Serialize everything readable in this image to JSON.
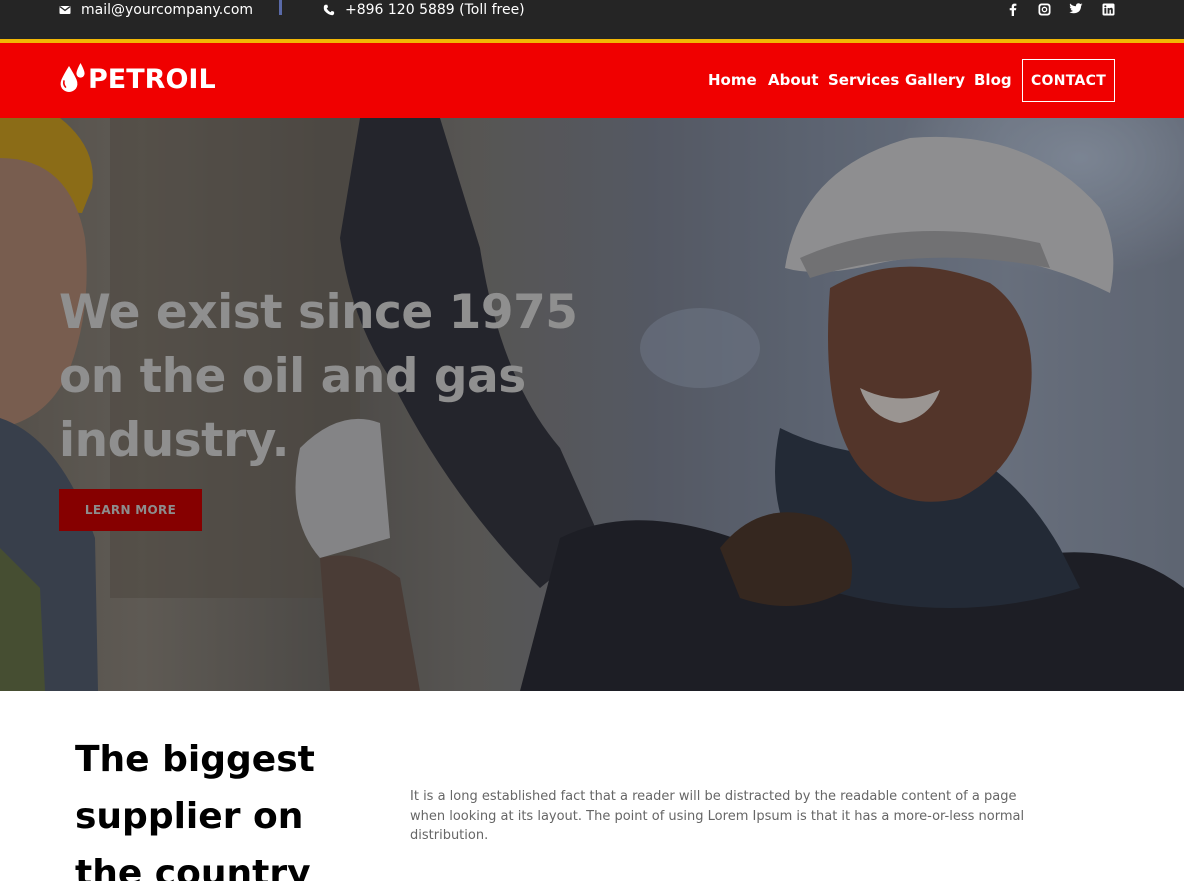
{
  "topbar": {
    "email": "mail@yourcompany.com",
    "phone": "+896 120 5889 (Toll free)",
    "social": [
      "facebook-icon",
      "instagram-icon",
      "twitter-icon",
      "linkedin-icon"
    ]
  },
  "header": {
    "logo_text": "PETROIL",
    "nav": [
      "Home",
      "About",
      "Services",
      "Gallery",
      "Blog"
    ],
    "contact_label": "CONTACT"
  },
  "hero": {
    "title": "We exist since 1975 on the oil and gas industry.",
    "button_label": "LEARN MORE"
  },
  "about": {
    "title": "The biggest supplier on the country",
    "text": "It is a long established fact that a reader will be distracted by the readable content of a page when looking at its layout. The point of using Lorem Ipsum is that it has a more-or-less normal distribution."
  },
  "colors": {
    "topbar": "#252525",
    "accent_stripe": "#f2b705",
    "header": "#f00000",
    "button": "#860000"
  }
}
